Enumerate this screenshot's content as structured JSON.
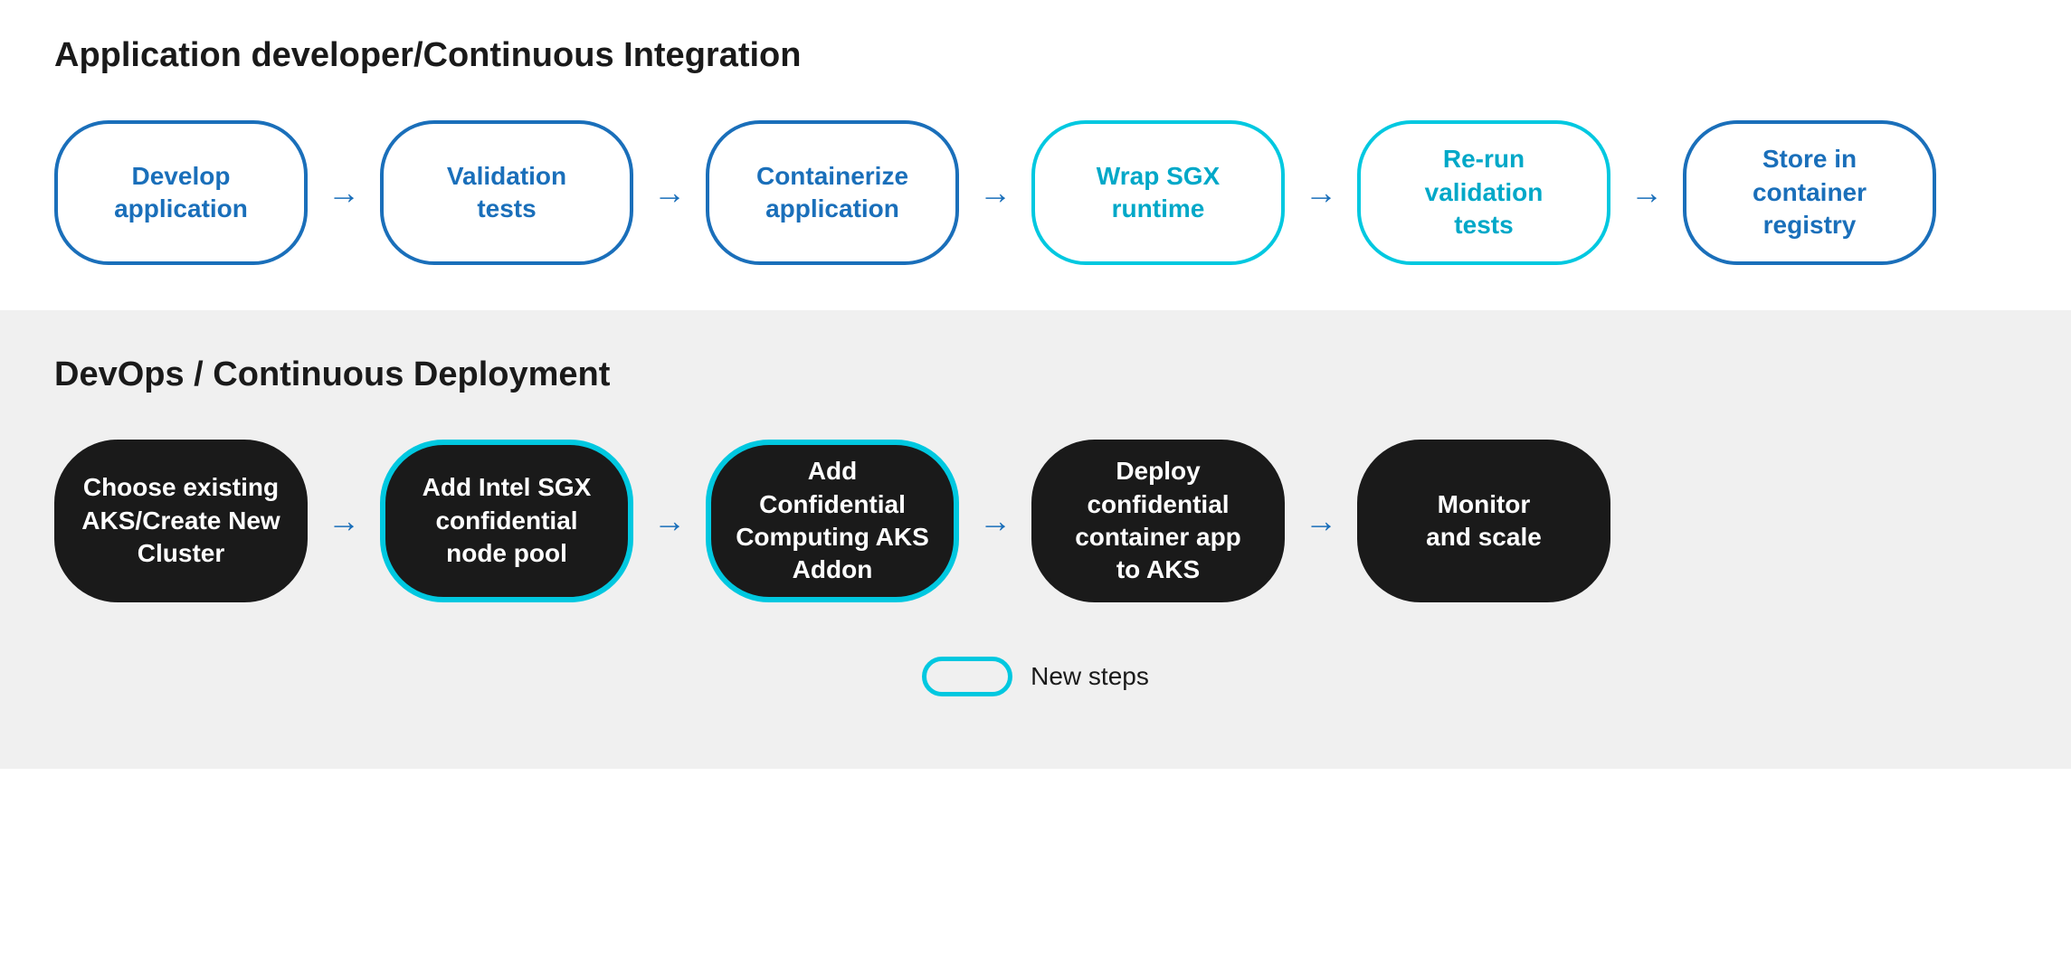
{
  "top_section": {
    "title": "Application developer/Continuous Integration",
    "nodes": [
      {
        "id": "develop",
        "label": "Develop\napplication",
        "highlight": false
      },
      {
        "id": "validation",
        "label": "Validation\ntests",
        "highlight": false
      },
      {
        "id": "containerize",
        "label": "Containerize\napplication",
        "highlight": false
      },
      {
        "id": "wrap-sgx",
        "label": "Wrap SGX\nruntime",
        "highlight": true
      },
      {
        "id": "rerun-validation",
        "label": "Re-run\nvalidation\ntests",
        "highlight": true
      },
      {
        "id": "store-registry",
        "label": "Store in\ncontainer\nregistry",
        "highlight": false
      }
    ]
  },
  "bottom_section": {
    "title": "DevOps / Continuous Deployment",
    "nodes": [
      {
        "id": "choose-aks",
        "label": "Choose existing\nAKS/Create New\nCluster",
        "highlight": false
      },
      {
        "id": "add-sgx",
        "label": "Add Intel SGX\nconfidential\nnode pool",
        "highlight": true
      },
      {
        "id": "add-cc",
        "label": "Add\nConfidential\nComputing AKS\nAddon",
        "highlight": true
      },
      {
        "id": "deploy-app",
        "label": "Deploy\nconfidential\ncontainer app\nto AKS",
        "highlight": false
      },
      {
        "id": "monitor",
        "label": "Monitor\nand scale",
        "highlight": false
      }
    ]
  },
  "legend": {
    "label": "New steps"
  }
}
